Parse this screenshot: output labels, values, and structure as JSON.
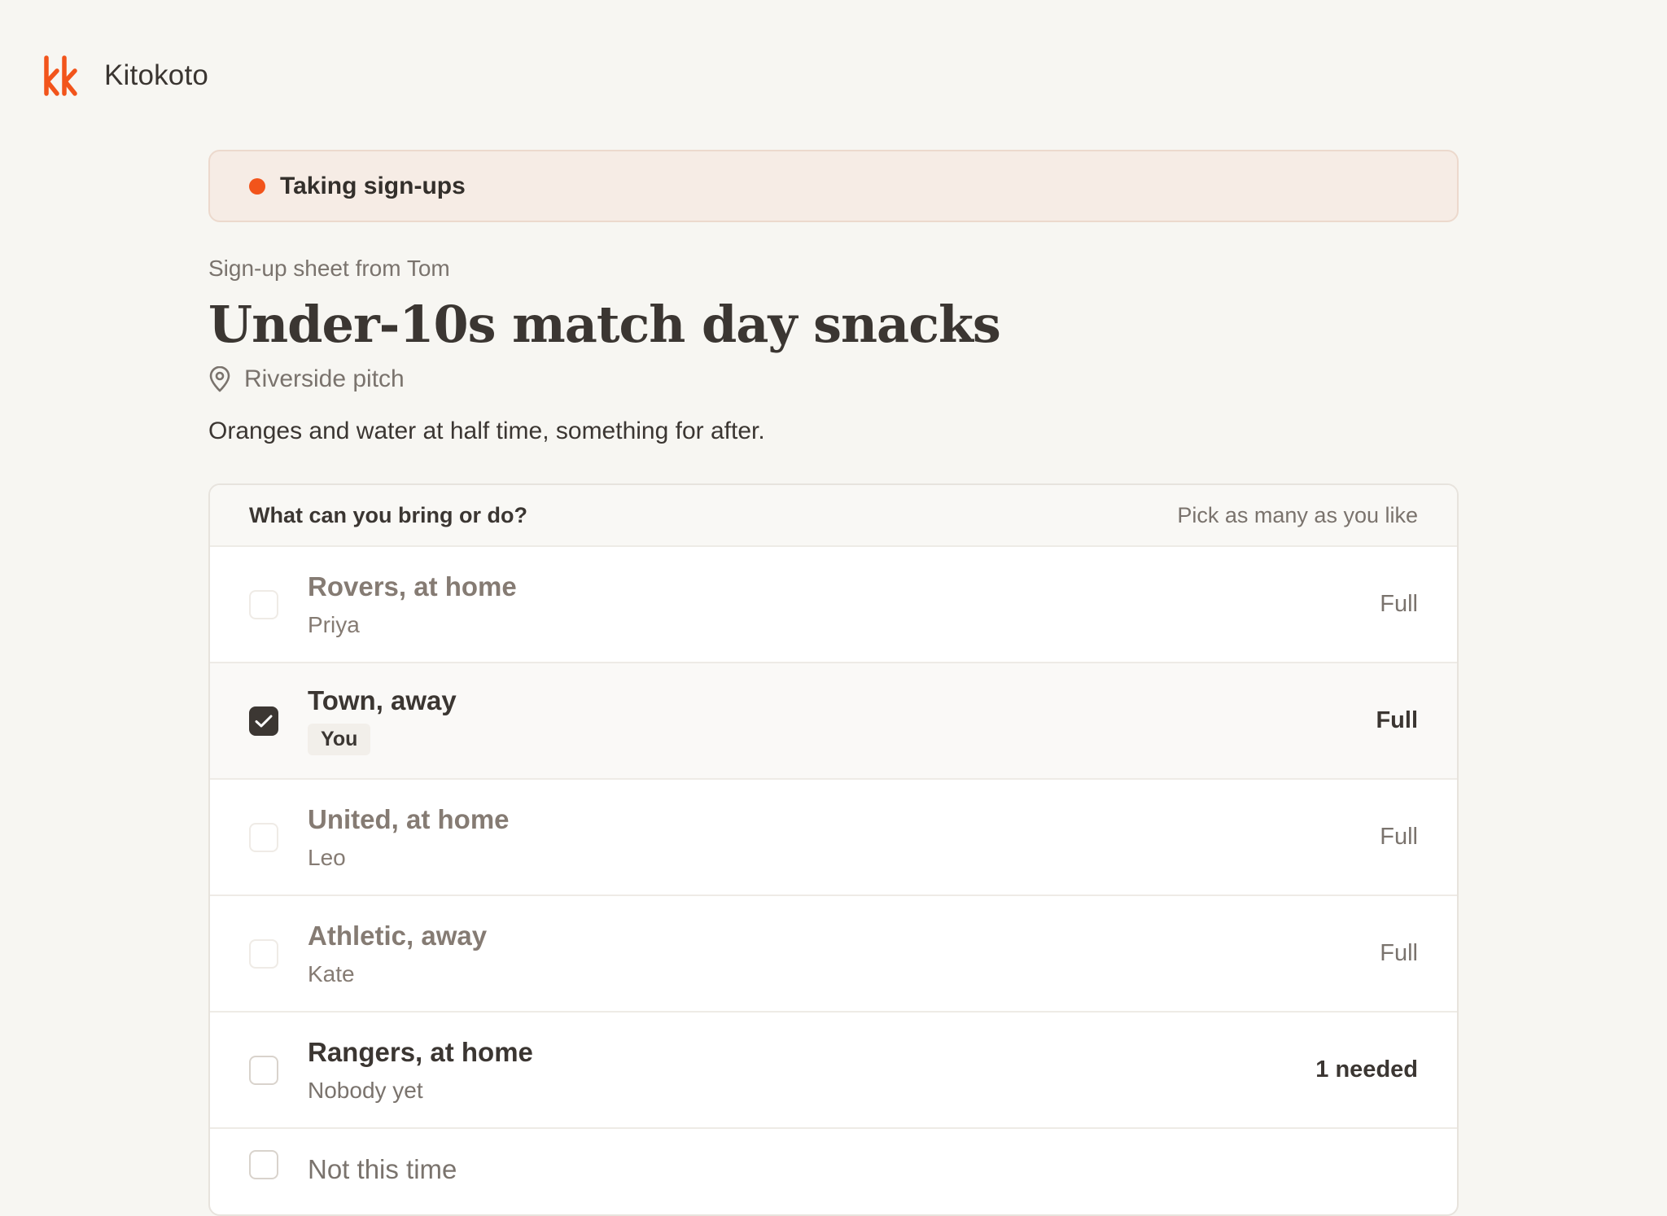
{
  "app": {
    "brand": "Kitokoto",
    "logo_icon": "kk-logo-icon",
    "accent_color": "#f2541b"
  },
  "status": {
    "label": "Taking sign-ups"
  },
  "sheet": {
    "kicker": "Sign-up sheet from Tom",
    "title": "Under-10s match day snacks",
    "location": "Riverside pitch",
    "description": "Oranges and water at half time, something for after."
  },
  "list": {
    "heading": "What can you bring or do?",
    "hint": "Pick as many as you like",
    "items": [
      {
        "title": "Rovers, at home",
        "sub": "Priya",
        "status": "Full",
        "checked": false
      },
      {
        "title": "Town, away",
        "sub": "You",
        "status": "Full",
        "checked": true
      },
      {
        "title": "United, at home",
        "sub": "Leo",
        "status": "Full",
        "checked": false
      },
      {
        "title": "Athletic, away",
        "sub": "Kate",
        "status": "Full",
        "checked": false
      },
      {
        "title": "Rangers, at home",
        "sub": "Nobody yet",
        "status": "1 needed",
        "checked": false
      },
      {
        "title": "Not this time",
        "checked": false
      }
    ]
  }
}
